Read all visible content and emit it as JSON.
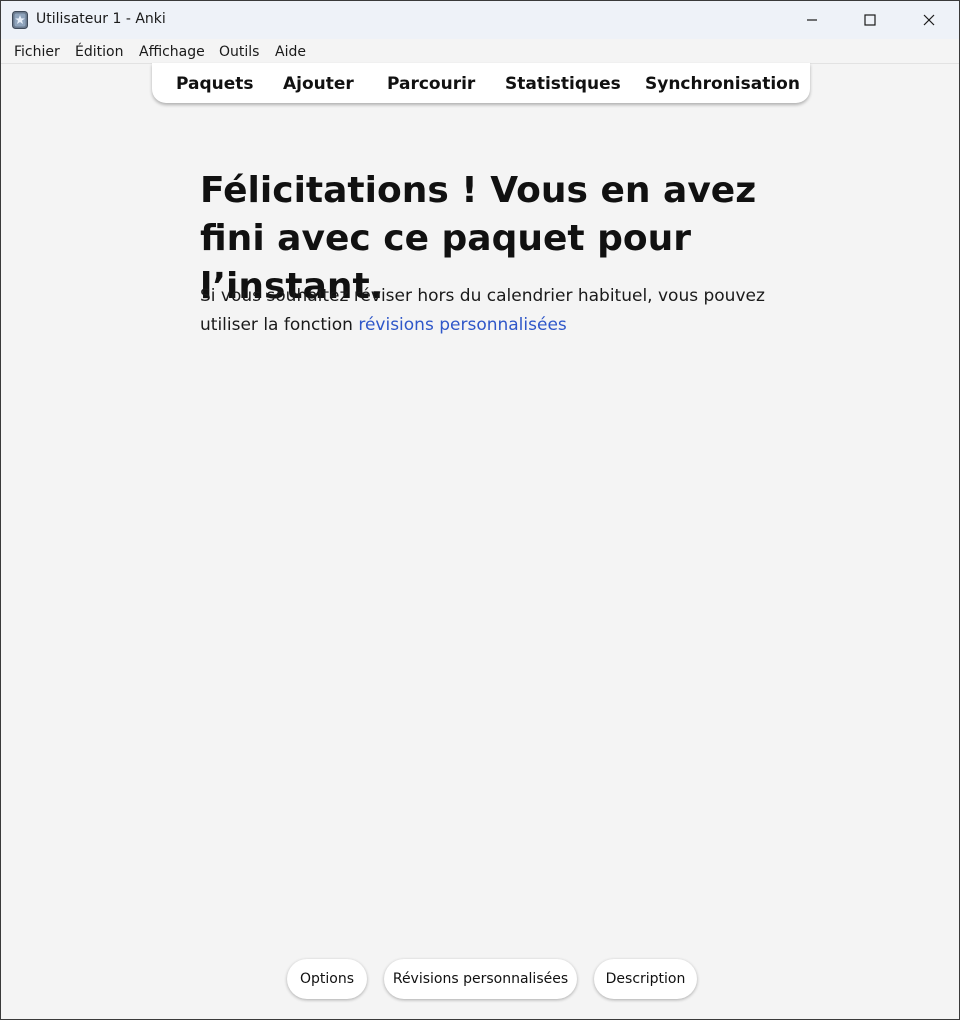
{
  "window": {
    "title": "Utilisateur 1 - Anki",
    "app_icon": "anki-icon",
    "controls": [
      "minimize-icon",
      "maximize-icon",
      "close-icon"
    ]
  },
  "menu": {
    "items": [
      "Fichier",
      "Édition",
      "Affichage",
      "Outils",
      "Aide"
    ]
  },
  "toolbar": {
    "items": [
      "Paquets",
      "Ajouter",
      "Parcourir",
      "Statistiques",
      "Synchronisation"
    ]
  },
  "main": {
    "heading": "Félicitations ! Vous en avez fini avec ce paquet pour l’instant.",
    "body_prefix": "Si vous souhaitez réviser hors du calendrier habituel, vous pouvez utiliser la fonction",
    "body_link": "révisions personnalisées"
  },
  "bottom": {
    "options_label": "Options",
    "custom_study_label": "Révisions personnalisées",
    "description_label": "Description"
  },
  "colors": {
    "background": "#f4f4f4",
    "titlebar": "#eef2f8",
    "link": "#2f57c9",
    "text": "#111111"
  }
}
